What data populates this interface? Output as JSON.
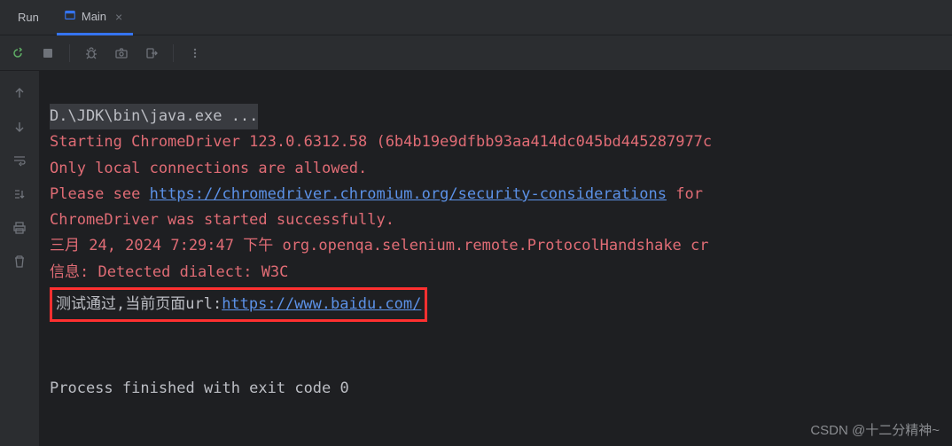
{
  "tabbar": {
    "run_label": "Run",
    "active_tab": "Main"
  },
  "console": {
    "top_fragment": "D.\\JDK\\bin\\java.exe ...",
    "line1_a": "Starting ChromeDriver 123.0.6312.58 (6b4b19e9dfbb93aa414dc045bd445287977c",
    "line2": "Only local connections are allowed.",
    "line3_a": "Please see ",
    "line3_link": "https://chromedriver.chromium.org/security-considerations",
    "line3_b": " for ",
    "line4": "ChromeDriver was started successfully.",
    "line5": "三月 24, 2024 7:29:47 下午 org.openqa.selenium.remote.ProtocolHandshake cr",
    "line6": "信息: Detected dialect: W3C",
    "line7_a": "测试通过,当前页面url:",
    "line7_link": "https://www.baidu.com/",
    "line8": "Process finished with exit code 0"
  },
  "watermark": "CSDN @十二分精神~"
}
